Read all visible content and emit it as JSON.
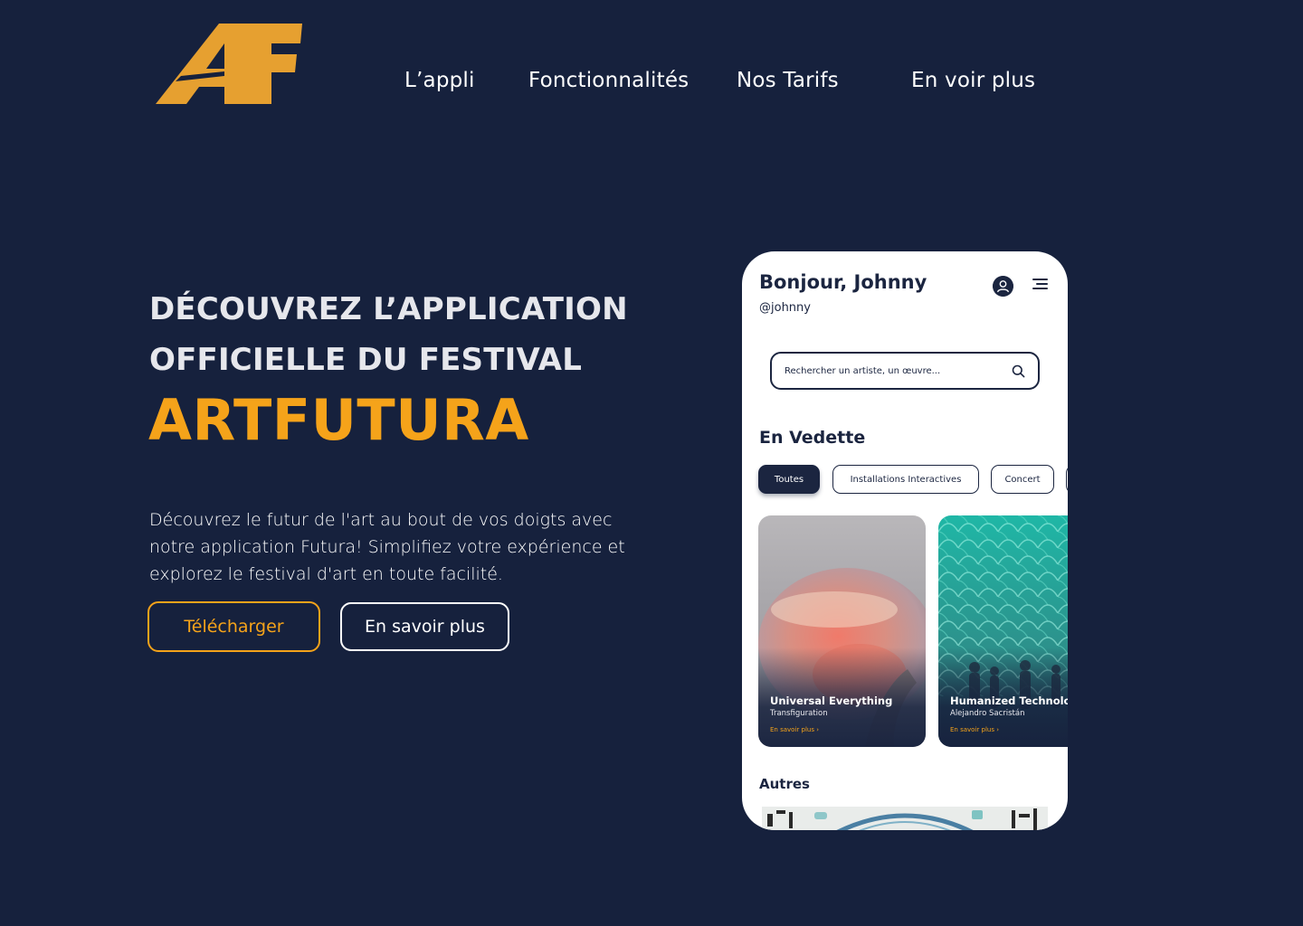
{
  "brand": {
    "logo_text": "AF",
    "accent": "#f5a31a",
    "background": "#16213d"
  },
  "nav": {
    "items": [
      {
        "label": "L’appli"
      },
      {
        "label": "Fonctionnalités"
      },
      {
        "label": "Nos Tarifs"
      },
      {
        "label": "En voir plus"
      }
    ]
  },
  "hero": {
    "line1": "DÉCOUVREZ L’APPLICATION",
    "line2": "OFFICIELLE DU FESTIVAL",
    "brand": "ARTFUTURA",
    "description": "Découvrez le futur de l'art au bout de vos doigts avec notre application Futura! Simplifiez votre expérience et explorez le festival d'art en toute facilité.",
    "primary_button": "Télécharger",
    "secondary_button": "En savoir plus"
  },
  "app": {
    "greeting": "Bonjour, Johnny",
    "handle": "@johnny",
    "user_icon": "user-icon",
    "menu_icon": "menu-icon",
    "search": {
      "placeholder": "Rechercher un artiste, un œuvre...",
      "icon": "search-icon"
    },
    "featured_title": "En Vedette",
    "chips": [
      {
        "label": "Toutes",
        "active": true
      },
      {
        "label": "Installations Interactives",
        "active": false
      },
      {
        "label": "Concert",
        "active": false
      },
      {
        "label": "",
        "active": false
      }
    ],
    "cards": [
      {
        "title": "Universal Everything",
        "subtitle": "Transfiguration",
        "link": "En savoir plus ›"
      },
      {
        "title": "Humanized Technology",
        "subtitle": "Alejandro Sacristán",
        "link": "En savoir plus ›"
      }
    ],
    "others_title": "Autres"
  }
}
